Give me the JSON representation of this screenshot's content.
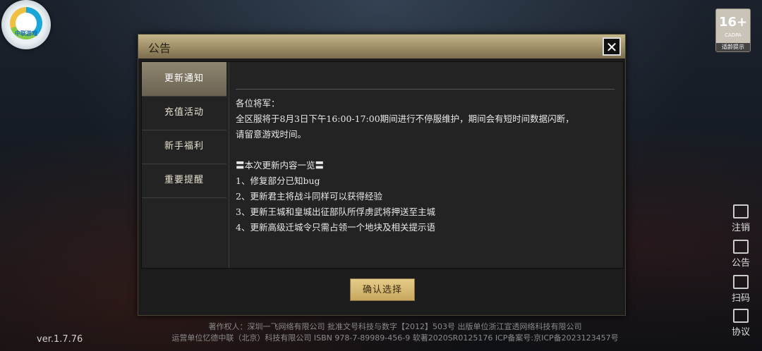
{
  "logo": {
    "text": "中联游戏"
  },
  "age_rating": {
    "number": "16+",
    "org": "CADPA",
    "tip": "适龄提示"
  },
  "side_menu": [
    {
      "label": "注销",
      "icon": "logout-icon"
    },
    {
      "label": "公告",
      "icon": "announcement-icon"
    },
    {
      "label": "扫码",
      "icon": "scan-icon"
    },
    {
      "label": "协议",
      "icon": "agreement-icon"
    }
  ],
  "version": "ver.1.7.76",
  "credits": {
    "line1": "著作权人：深圳一飞网络有限公司 批准文号科技与数字【2012】503号 出版单位浙江宣透网络科技有限公司",
    "line2": "运营单位忆德中联（北京）科技有限公司 ISBN 978-7-89989-456-9 软著2020SR0125176 ICP备案号:京ICP备2023123457号"
  },
  "dialog": {
    "title": "公告",
    "close_label": "✕",
    "tabs": [
      {
        "label": "更新通知",
        "active": true
      },
      {
        "label": "充值活动",
        "active": false
      },
      {
        "label": "新手福利",
        "active": false
      },
      {
        "label": "重要提醒",
        "active": false
      }
    ],
    "content": {
      "greeting": "各位将军：",
      "line1": "全区服将于8月3日下午16:00-17:00期间进行不停服维护，期间会有短时间数据闪断，",
      "line2": "请留意游戏时间。",
      "section_title": "〓本次更新内容一览〓",
      "items": [
        "1、修复部分已知bug",
        "2、更新君主将战斗同样可以获得经验",
        "3、更新王城和皇城出征部队所俘虏武将押送至主城",
        "4、更新高级迁城令只需占领一个地块及相关提示语"
      ]
    },
    "confirm_label": "确认选择"
  },
  "colors": {
    "accent": "#c8a85e",
    "title_bar": "#a89870",
    "active_tab": "#7b735f"
  }
}
